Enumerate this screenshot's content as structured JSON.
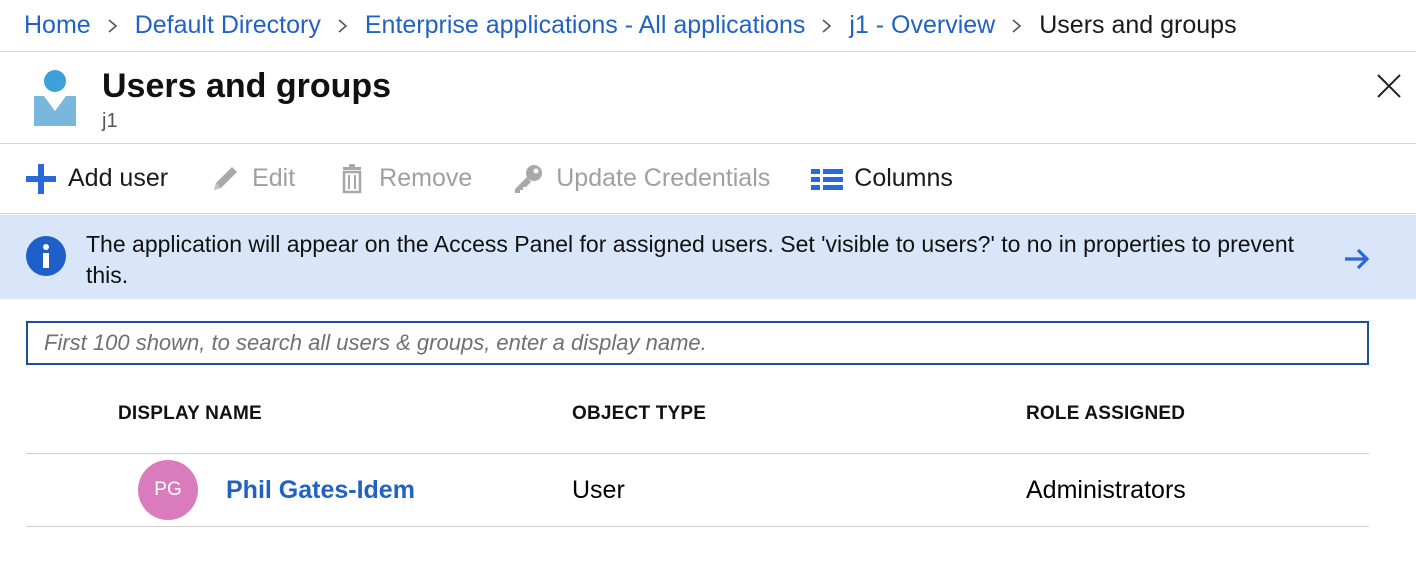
{
  "breadcrumb": {
    "items": [
      {
        "label": "Home"
      },
      {
        "label": "Default Directory"
      },
      {
        "label": "Enterprise applications - All applications"
      },
      {
        "label": "j1 - Overview"
      }
    ],
    "current": "Users and groups"
  },
  "header": {
    "title": "Users and groups",
    "subtitle": "j1",
    "icon": "user-blade-icon",
    "close_icon": "close-icon"
  },
  "toolbar": {
    "add_user": "Add user",
    "edit": "Edit",
    "remove": "Remove",
    "update_credentials": "Update Credentials",
    "columns": "Columns"
  },
  "info_banner": {
    "text": "The application will appear on the Access Panel for assigned users. Set 'visible to users?' to no in properties to prevent this."
  },
  "search": {
    "placeholder": "First 100 shown, to search all users & groups, enter a display name.",
    "value": ""
  },
  "table": {
    "columns": [
      "DISPLAY NAME",
      "OBJECT TYPE",
      "ROLE ASSIGNED"
    ],
    "rows": [
      {
        "initials": "PG",
        "display_name": "Phil Gates-Idem",
        "object_type": "User",
        "role": "Administrators"
      }
    ]
  },
  "colors": {
    "link": "#2162c5",
    "banner_bg": "#d9e6fa",
    "avatar_bg": "#da7bbd",
    "accent_blue": "#2a6ad8"
  }
}
